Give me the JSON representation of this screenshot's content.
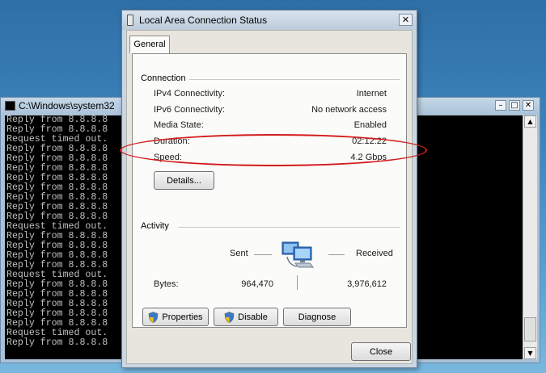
{
  "console": {
    "title": "C:\\Windows\\system32",
    "lines": [
      "Reply from 8.8.8.8",
      "Reply from 8.8.8.8",
      "Request timed out.",
      "Reply from 8.8.8.8",
      "Reply from 8.8.8.8",
      "Reply from 8.8.8.8",
      "Reply from 8.8.8.8",
      "Reply from 8.8.8.8",
      "Reply from 8.8.8.8",
      "Reply from 8.8.8.8",
      "Reply from 8.8.8.8",
      "Request timed out.",
      "Reply from 8.8.8.8",
      "Reply from 8.8.8.8",
      "Reply from 8.8.8.8",
      "Reply from 8.8.8.8",
      "Request timed out.",
      "Reply from 8.8.8.8",
      "Reply from 8.8.8.8",
      "Reply from 8.8.8.8",
      "Reply from 8.8.8.8",
      "Reply from 8.8.8.8",
      "Request timed out.",
      "Reply from 8.8.8.8"
    ],
    "minimize": "–",
    "maximize": "□",
    "close": "✕",
    "scroll_up": "▲",
    "scroll_down": "▼"
  },
  "dialog": {
    "title": "Local Area Connection Status",
    "close": "✕",
    "tab": "General",
    "connection": {
      "title": "Connection",
      "rows": [
        {
          "label": "IPv4 Connectivity:",
          "value": "Internet"
        },
        {
          "label": "IPv6 Connectivity:",
          "value": "No network access"
        },
        {
          "label": "Media State:",
          "value": "Enabled"
        },
        {
          "label": "Duration:",
          "value": "02:12:22"
        },
        {
          "label": "Speed:",
          "value": "4.2 Gbps"
        }
      ],
      "details_button": "Details..."
    },
    "activity": {
      "title": "Activity",
      "sent_label": "Sent",
      "received_label": "Received",
      "bytes_label": "Bytes:",
      "bytes_sent": "964,470",
      "bytes_received": "3,976,612"
    },
    "buttons": {
      "properties": "Properties",
      "disable": "Disable",
      "diagnose": "Diagnose",
      "close": "Close"
    }
  },
  "colors": {
    "highlight_ellipse": "#d21c1c",
    "console_bg": "#000000",
    "console_text": "#c0c0c0"
  }
}
